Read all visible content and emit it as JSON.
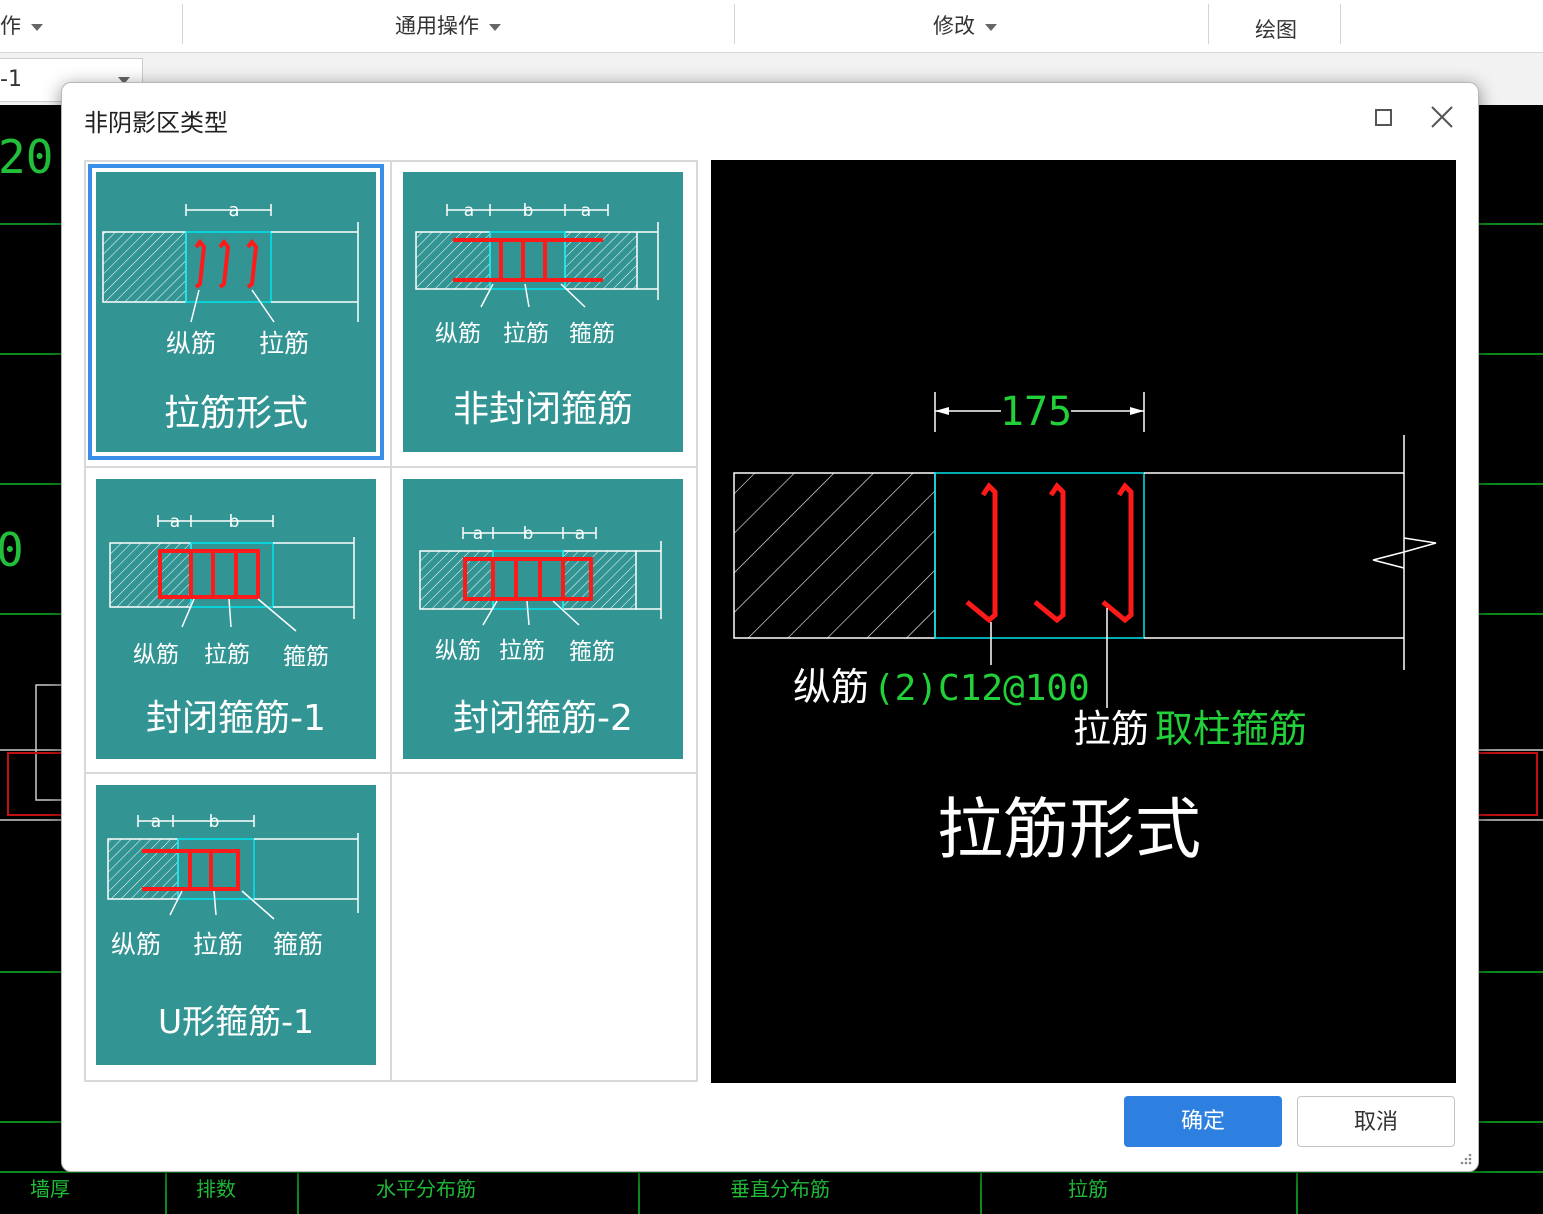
{
  "toolbar": {
    "group1": "作",
    "group2": "通用操作",
    "group3": "修改",
    "group4": "绘图",
    "combo_value": "-1"
  },
  "cad": {
    "left_texts": [
      "20",
      "0"
    ],
    "bottom_headers": [
      "墙厚",
      "排数",
      "水平分布筋",
      "垂直分布筋",
      "拉筋"
    ]
  },
  "dialog": {
    "title": "非阴影区类型",
    "ok_label": "确定",
    "cancel_label": "取消",
    "options": [
      {
        "title": "拉筋形式",
        "labels": [
          "纵筋",
          "拉筋"
        ],
        "dims": "a",
        "selected": true
      },
      {
        "title": "非封闭箍筋",
        "labels": [
          "纵筋",
          "拉筋",
          "箍筋"
        ],
        "dims": "a b a",
        "selected": false
      },
      {
        "title": "封闭箍筋-1",
        "labels": [
          "纵筋",
          "拉筋",
          "箍筋"
        ],
        "dims": "a b",
        "selected": false
      },
      {
        "title": "封闭箍筋-2",
        "labels": [
          "纵筋",
          "拉筋",
          "箍筋"
        ],
        "dims": "a b a",
        "selected": false
      },
      {
        "title": "U形箍筋-1",
        "labels": [
          "纵筋",
          "拉筋",
          "箍筋"
        ],
        "dims": "a b",
        "selected": false
      }
    ],
    "preview": {
      "dimension": "175",
      "longitudinal_label": "纵筋",
      "longitudinal_value": "(2)C12@100",
      "tie_label": "拉筋",
      "tie_value": "取柱箍筋",
      "title": "拉筋形式"
    }
  },
  "colors": {
    "teal": "#339494",
    "rebar": "#ff1a1a",
    "cyan": "#00e5ee",
    "cad_green": "#22c03a",
    "accent": "#2d7fe0"
  }
}
